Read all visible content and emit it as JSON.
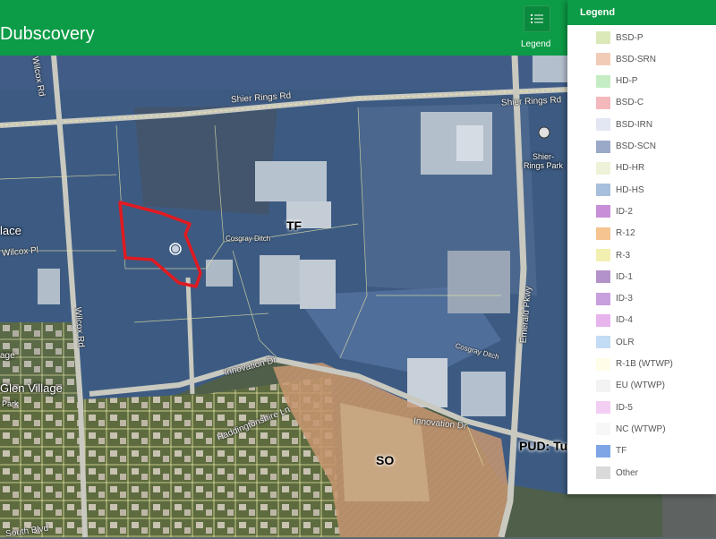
{
  "app": {
    "title": "Dubscovery"
  },
  "toolbar": {
    "legend_label": "Legend"
  },
  "legend": {
    "title": "Legend",
    "items": [
      {
        "label": "BSD-P",
        "color": "#dbe9b9"
      },
      {
        "label": "BSD-SRN",
        "color": "#f2cbb7"
      },
      {
        "label": "HD-P",
        "color": "#c4edc4"
      },
      {
        "label": "BSD-C",
        "color": "#f4b8bc"
      },
      {
        "label": "BSD-IRN",
        "color": "#e3e7f3"
      },
      {
        "label": "BSD-SCN",
        "color": "#9aa9c8"
      },
      {
        "label": "HD-HR",
        "color": "#eef2d8"
      },
      {
        "label": "HD-HS",
        "color": "#a7bfdc"
      },
      {
        "label": "ID-2",
        "color": "#c88fd8"
      },
      {
        "label": "R-12",
        "color": "#f5c490"
      },
      {
        "label": "R-3",
        "color": "#f3efb0"
      },
      {
        "label": "ID-1",
        "color": "#b391c9"
      },
      {
        "label": "ID-3",
        "color": "#c8a0de"
      },
      {
        "label": "ID-4",
        "color": "#e7b4ee"
      },
      {
        "label": "OLR",
        "color": "#c3dbf4"
      },
      {
        "label": "R-1B (WTWP)",
        "color": "#fffde8"
      },
      {
        "label": "EU (WTWP)",
        "color": "#f3f3f3"
      },
      {
        "label": "ID-5",
        "color": "#f3cef3"
      },
      {
        "label": "NC (WTWP)",
        "color": "#f7f7f7"
      },
      {
        "label": "TF",
        "color": "#7ea6e6"
      },
      {
        "label": "Other",
        "color": "#d9d9d9"
      }
    ]
  },
  "map": {
    "zones": {
      "tf": "TF",
      "so": "SO",
      "pud": "PUD: Tu"
    },
    "roads": {
      "shier_rings_w": "Shier Rings Rd",
      "shier_rings_e": "Shier Rings Rd",
      "wilcox_top": "Wilcox Rd",
      "wilcox_pl": "Wilcox Pl",
      "wilcox_lower": "Wilcox Rd",
      "innovation_w": "Innovation Dr",
      "innovation_e": "Innovation Dr",
      "emerald": "Emerald Pkwy",
      "haddingtonshire": "Haddingtonshire Ln",
      "cosgray_ditch_1": "Cosgray Ditch",
      "cosgray_ditch_2": "Cosgray Ditch",
      "south_blvd": "South Blvd"
    },
    "places": {
      "glen_village": "Glen Village",
      "lace": "lace",
      "park_right": "Shier-Rings Park",
      "park_left": "Park",
      "age": "age"
    }
  }
}
